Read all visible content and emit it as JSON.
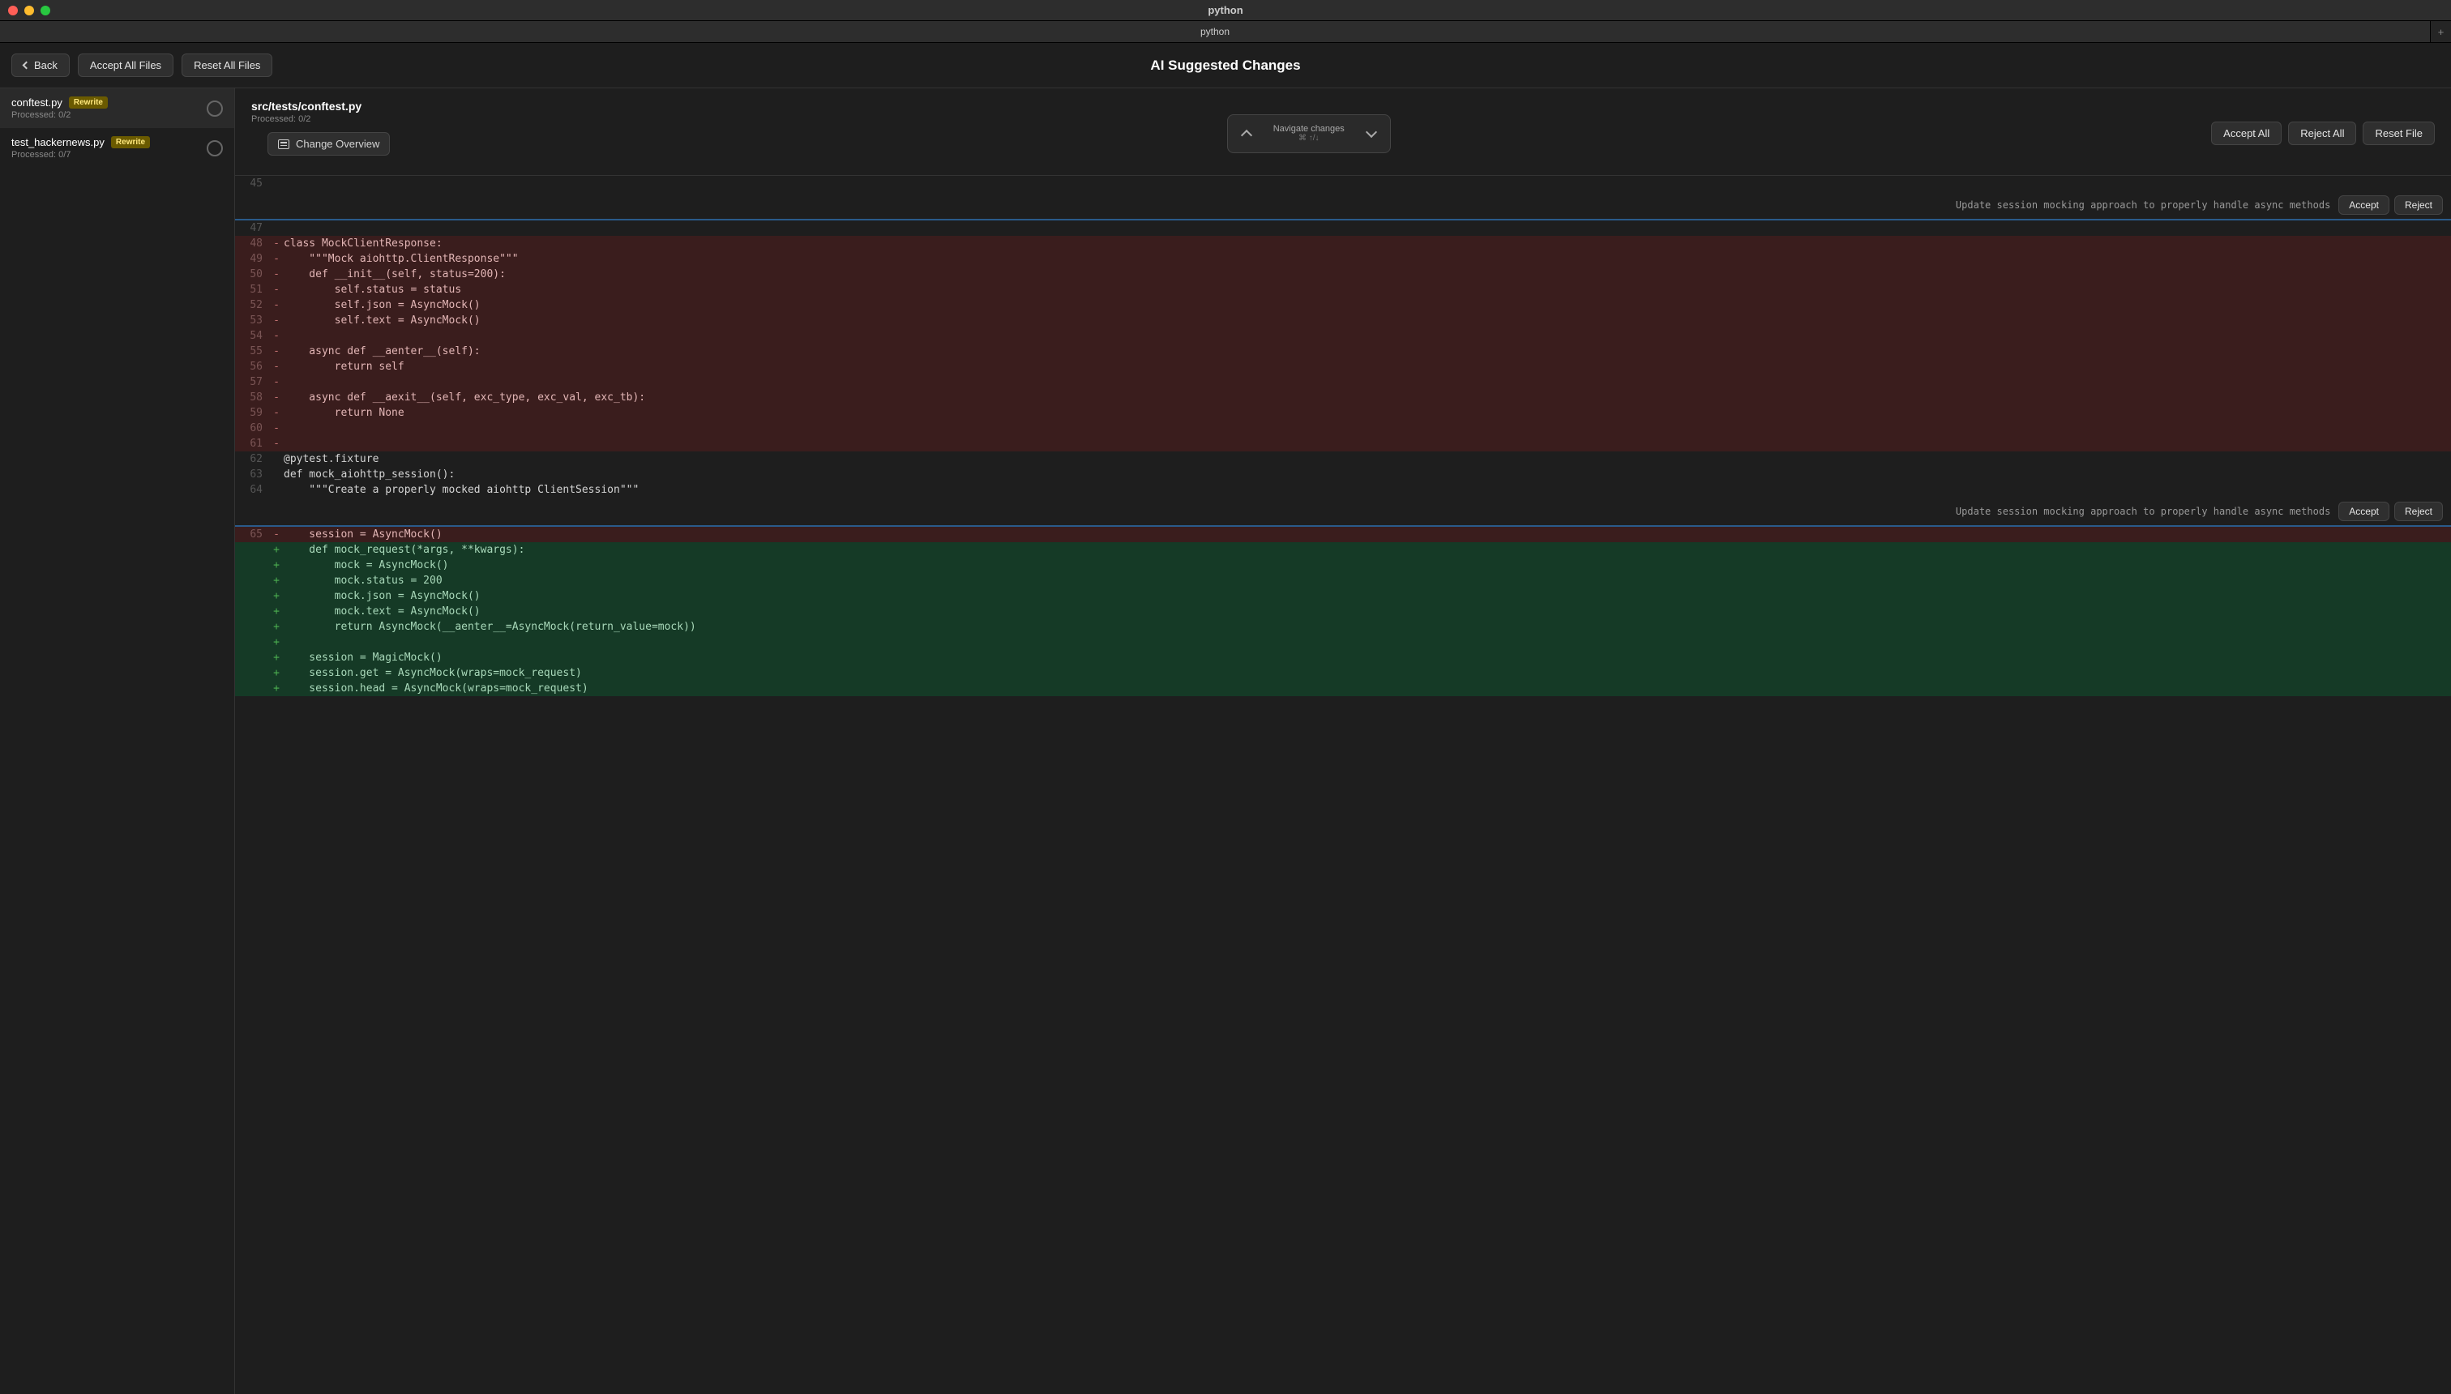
{
  "window": {
    "title": "python"
  },
  "tab": {
    "label": "python"
  },
  "toolbar": {
    "back": "Back",
    "accept_all_files": "Accept All Files",
    "reset_all_files": "Reset All Files",
    "title": "AI Suggested Changes"
  },
  "sidebar": {
    "files": [
      {
        "name": "conftest.py",
        "badge": "Rewrite",
        "processed": "Processed: 0/2",
        "selected": true
      },
      {
        "name": "test_hackernews.py",
        "badge": "Rewrite",
        "processed": "Processed: 0/7",
        "selected": false
      }
    ]
  },
  "content_header": {
    "path": "src/tests/conftest.py",
    "processed": "Processed: 0/2",
    "nav_label": "Navigate changes",
    "nav_hint": "⌘ ↑/↓",
    "accept_all": "Accept All",
    "reject_all": "Reject All",
    "reset_file": "Reset File",
    "change_overview": "Change Overview"
  },
  "hunk_common": {
    "desc": "Update session mocking approach to properly handle async methods",
    "accept": "Accept",
    "reject": "Reject"
  },
  "code": [
    {
      "n": "45",
      "m": "",
      "t": "",
      "cls": "ctx"
    },
    {
      "n": "",
      "m": "",
      "t": "",
      "cls": "hunk0"
    },
    {
      "n": "47",
      "m": "",
      "t": "",
      "cls": "ctx"
    },
    {
      "n": "48",
      "m": "-",
      "t": "class MockClientResponse:",
      "cls": "del"
    },
    {
      "n": "49",
      "m": "-",
      "t": "    \"\"\"Mock aiohttp.ClientResponse\"\"\"",
      "cls": "del"
    },
    {
      "n": "50",
      "m": "-",
      "t": "    def __init__(self, status=200):",
      "cls": "del"
    },
    {
      "n": "51",
      "m": "-",
      "t": "        self.status = status",
      "cls": "del"
    },
    {
      "n": "52",
      "m": "-",
      "t": "        self.json = AsyncMock()",
      "cls": "del"
    },
    {
      "n": "53",
      "m": "-",
      "t": "        self.text = AsyncMock()",
      "cls": "del"
    },
    {
      "n": "54",
      "m": "-",
      "t": "",
      "cls": "del"
    },
    {
      "n": "55",
      "m": "-",
      "t": "    async def __aenter__(self):",
      "cls": "del"
    },
    {
      "n": "56",
      "m": "-",
      "t": "        return self",
      "cls": "del"
    },
    {
      "n": "57",
      "m": "-",
      "t": "",
      "cls": "del"
    },
    {
      "n": "58",
      "m": "-",
      "t": "    async def __aexit__(self, exc_type, exc_val, exc_tb):",
      "cls": "del"
    },
    {
      "n": "59",
      "m": "-",
      "t": "        return None",
      "cls": "del"
    },
    {
      "n": "60",
      "m": "-",
      "t": "",
      "cls": "del"
    },
    {
      "n": "61",
      "m": "-",
      "t": "",
      "cls": "del"
    },
    {
      "n": "62",
      "m": "",
      "t": "@pytest.fixture",
      "cls": "ctx"
    },
    {
      "n": "63",
      "m": "",
      "t": "def mock_aiohttp_session():",
      "cls": "ctx"
    },
    {
      "n": "64",
      "m": "",
      "t": "    \"\"\"Create a properly mocked aiohttp ClientSession\"\"\"",
      "cls": "ctx"
    },
    {
      "n": "",
      "m": "",
      "t": "",
      "cls": "hunk1"
    },
    {
      "n": "65",
      "m": "-",
      "t": "    session = AsyncMock()",
      "cls": "del"
    },
    {
      "n": "",
      "m": "+",
      "t": "    def mock_request(*args, **kwargs):",
      "cls": "add"
    },
    {
      "n": "",
      "m": "+",
      "t": "        mock = AsyncMock()",
      "cls": "add"
    },
    {
      "n": "",
      "m": "+",
      "t": "        mock.status = 200",
      "cls": "add"
    },
    {
      "n": "",
      "m": "+",
      "t": "        mock.json = AsyncMock()",
      "cls": "add"
    },
    {
      "n": "",
      "m": "+",
      "t": "        mock.text = AsyncMock()",
      "cls": "add"
    },
    {
      "n": "",
      "m": "+",
      "t": "        return AsyncMock(__aenter__=AsyncMock(return_value=mock))",
      "cls": "add"
    },
    {
      "n": "",
      "m": "+",
      "t": "",
      "cls": "add"
    },
    {
      "n": "",
      "m": "+",
      "t": "    session = MagicMock()",
      "cls": "add"
    },
    {
      "n": "",
      "m": "+",
      "t": "    session.get = AsyncMock(wraps=mock_request)",
      "cls": "add"
    },
    {
      "n": "",
      "m": "+",
      "t": "    session.head = AsyncMock(wraps=mock_request)",
      "cls": "add"
    }
  ]
}
